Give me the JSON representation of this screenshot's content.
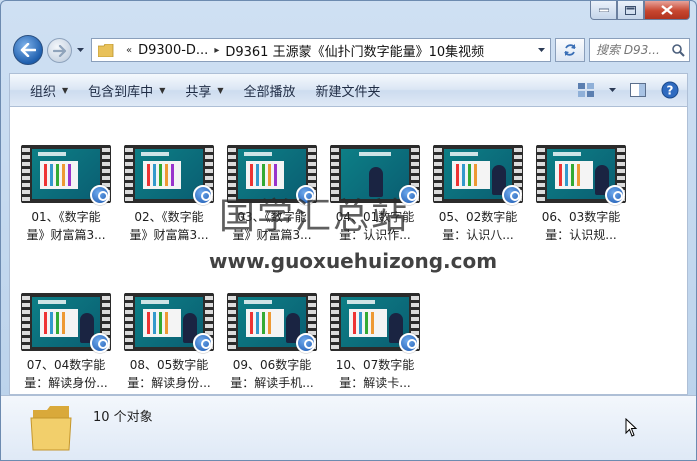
{
  "window": {
    "buttons": {
      "minimize": "minimize",
      "maximize": "maximize",
      "close": "close"
    }
  },
  "address": {
    "breadcrumbs": [
      "D9300-D...",
      "D9361 王源蒙《仙扑门数字能量》10集视频"
    ],
    "overflow": "«"
  },
  "search": {
    "placeholder": "搜索 D93..."
  },
  "toolbar": {
    "organize": "组织",
    "include_in_library": "包含到库中",
    "share": "共享",
    "play_all": "全部播放",
    "new_folder": "新建文件夹"
  },
  "files": [
    {
      "line1": "01、《数字能",
      "line2": "量》财富篇3..."
    },
    {
      "line1": "02、《数字能",
      "line2": "量》财富篇3..."
    },
    {
      "line1": "03、《数字能",
      "line2": "量》财富篇3..."
    },
    {
      "line1": "04、01数字能",
      "line2": "量：认识作..."
    },
    {
      "line1": "05、02数字能",
      "line2": "量：认识八..."
    },
    {
      "line1": "06、03数字能",
      "line2": "量：认识规..."
    },
    {
      "line1": "07、04数字能",
      "line2": "量：解读身份..."
    },
    {
      "line1": "08、05数字能",
      "line2": "量：解读身份..."
    },
    {
      "line1": "09、06数字能",
      "line2": "量：解读手机..."
    },
    {
      "line1": "10、07数字能",
      "line2": "量：解读卡..."
    }
  ],
  "watermark": {
    "chinese": "国学汇总站",
    "url": "www.guoxuehuizong.com"
  },
  "details": {
    "count_text": "10 个对象"
  },
  "colors": {
    "accent": "#1f5fae",
    "close": "#c7462f",
    "video_bg": "#0d7f86"
  }
}
